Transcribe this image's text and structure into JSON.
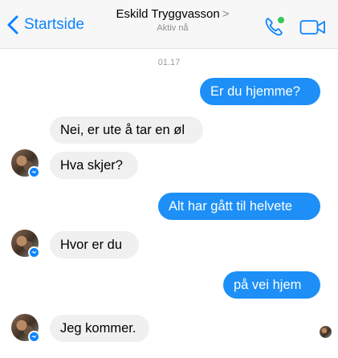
{
  "header": {
    "back_label": "Startside",
    "contact_name": "Eskild Tryggvasson",
    "contact_chevron": ">",
    "status": "Aktiv nå",
    "call_icon": "phone-icon",
    "video_icon": "video-camera-icon",
    "online_dot_color": "#34c759"
  },
  "colors": {
    "accent": "#0b84ff",
    "sent_bubble": "#1d8ff7",
    "received_bubble": "#f0f0f0"
  },
  "conversation": {
    "timestamp": "01.17",
    "messages": [
      {
        "from": "me",
        "text": "Er du hjemme?"
      },
      {
        "from": "them",
        "text": "Nei, er ute å tar en øl"
      },
      {
        "from": "them",
        "text": "Hva skjer?"
      },
      {
        "from": "me",
        "text": "Alt har gått til helvete"
      },
      {
        "from": "them",
        "text": "Hvor er du"
      },
      {
        "from": "me",
        "text": "på vei hjem"
      },
      {
        "from": "them",
        "text": "Jeg kommer."
      }
    ]
  }
}
